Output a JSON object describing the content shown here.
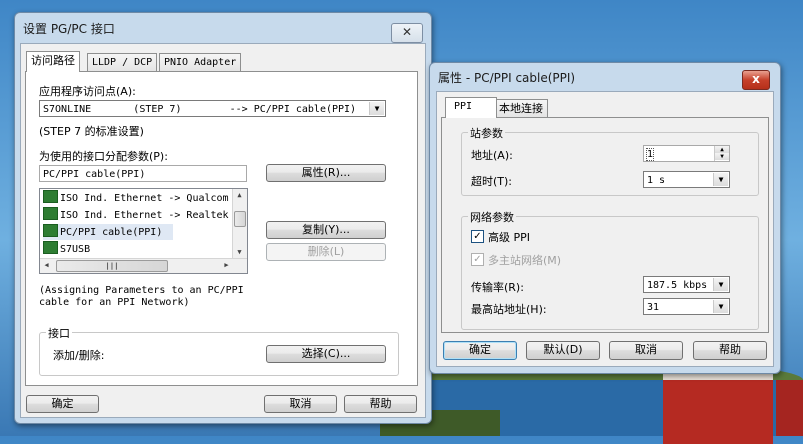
{
  "dlg1": {
    "title": "设置 PG/PC 接口",
    "close": "✕",
    "tabs": [
      "访问路径",
      "LLDP / DCP",
      "PNIO Adapter"
    ],
    "access_point_label": "应用程序访问点(A):",
    "access_point_value": "S7ONLINE       (STEP 7)        --> PC/PPI cable(PPI)",
    "std_setting": "(STEP 7 的标准设置)",
    "param_label": "为使用的接口分配参数(P):",
    "param_value": "PC/PPI cable(PPI)",
    "list_items": [
      "ISO Ind. Ethernet -> Qualcom",
      "ISO Ind. Ethernet -> Realtek",
      "PC/PPI cable(PPI)",
      "S7USB"
    ],
    "btn_properties": "属性(R)...",
    "btn_copy": "复制(Y)...",
    "btn_delete": "删除(L)",
    "description": [
      "(Assigning Parameters to an PC/PPI",
      "cable for an PPI Network)"
    ],
    "interface_group": "接口",
    "add_remove_label": "添加/删除:",
    "btn_select": "选择(C)...",
    "btn_ok": "确定",
    "btn_cancel": "取消",
    "btn_help": "帮助"
  },
  "dlg2": {
    "title": "属性 - PC/PPI cable(PPI)",
    "close": "x",
    "tabs": [
      "PPI",
      "本地连接"
    ],
    "station_group": "站参数",
    "address_label": "地址(A):",
    "address_value": "1",
    "timeout_label": "超时(T):",
    "timeout_value": "1 s",
    "network_group": "网络参数",
    "advanced_ppi": "高级 PPI",
    "advanced_ppi_checked": true,
    "multimaster": "多主站网络(M)",
    "multimaster_checked": true,
    "baud_label": "传输率(R):",
    "baud_value": "187.5 kbps",
    "highest_addr_label": "最高站地址(H):",
    "highest_addr_value": "31",
    "btn_ok": "确定",
    "btn_default": "默认(D)",
    "btn_cancel": "取消",
    "btn_help": "帮助"
  },
  "icons": {
    "list_item": "network-adapter-icon",
    "check": "check-mark-icon"
  }
}
